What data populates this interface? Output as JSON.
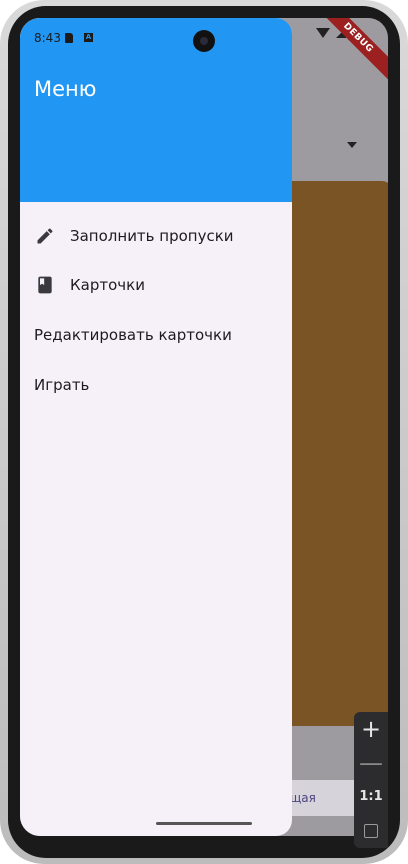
{
  "status_bar": {
    "time": "8:43",
    "icons": [
      "sd-card-icon",
      "a-icon",
      "wifi-icon",
      "signal-icon"
    ]
  },
  "debug_banner": "DEBUG",
  "drawer": {
    "title": "Меню",
    "header_color": "#2196f3",
    "items": [
      {
        "label": "Заполнить пропуски",
        "icon": "pencil-icon"
      },
      {
        "label": "Карточки",
        "icon": "book-icon"
      },
      {
        "label": "Редактировать карточки"
      },
      {
        "label": "Играть"
      }
    ]
  },
  "underlay": {
    "pill_label": "щая",
    "card_color": "#7b5425"
  },
  "zoom_controls": {
    "plus": "+",
    "minus": "—",
    "reset": "1:1"
  }
}
